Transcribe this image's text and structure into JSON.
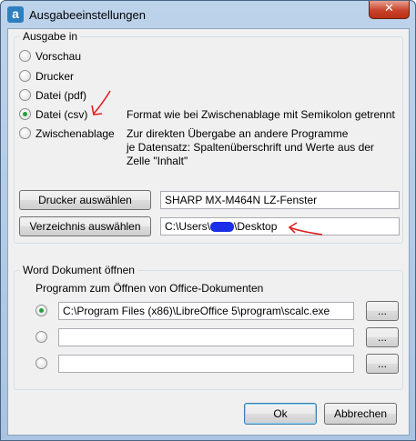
{
  "window": {
    "title": "Ausgabeeinstellungen",
    "app_icon_letter": "a",
    "close_glyph": "✕"
  },
  "output_group": {
    "legend": "Ausgabe in",
    "options": [
      {
        "label": "Vorschau",
        "checked": false
      },
      {
        "label": "Drucker",
        "checked": false
      },
      {
        "label": "Datei (pdf)",
        "checked": false
      },
      {
        "label": "Datei (csv)",
        "checked": true
      },
      {
        "label": "Zwischenablage",
        "checked": false
      }
    ],
    "csv_description": "Format wie bei Zwischenablage mit Semikolon getrennt",
    "clipboard_description": [
      "Zur direkten Übergabe an andere Programme",
      "je Datensatz: Spaltenüberschrift und Werte aus der",
      "Zelle \"Inhalt\""
    ],
    "select_printer_button": "Drucker auswählen",
    "printer_value": "SHARP MX-M464N LZ-Fenster",
    "select_folder_button": "Verzeichnis auswählen",
    "folder_value_prefix": "C:\\Users\\",
    "folder_value_suffix": "\\Desktop"
  },
  "word_group": {
    "legend": "Word Dokument öffnen",
    "program_label": "Programm zum Öffnen von Office-Dokumenten",
    "programs": [
      {
        "path": "C:\\Program Files (x86)\\LibreOffice 5\\program\\scalc.exe",
        "checked": true
      },
      {
        "path": "",
        "checked": false
      },
      {
        "path": "",
        "checked": false
      }
    ],
    "browse_label": "..."
  },
  "footer": {
    "ok_label": "Ok",
    "cancel_label": "Abbrechen"
  },
  "colors": {
    "annotation_red": "#e02020",
    "redaction_blue": "#1b2ee8"
  }
}
